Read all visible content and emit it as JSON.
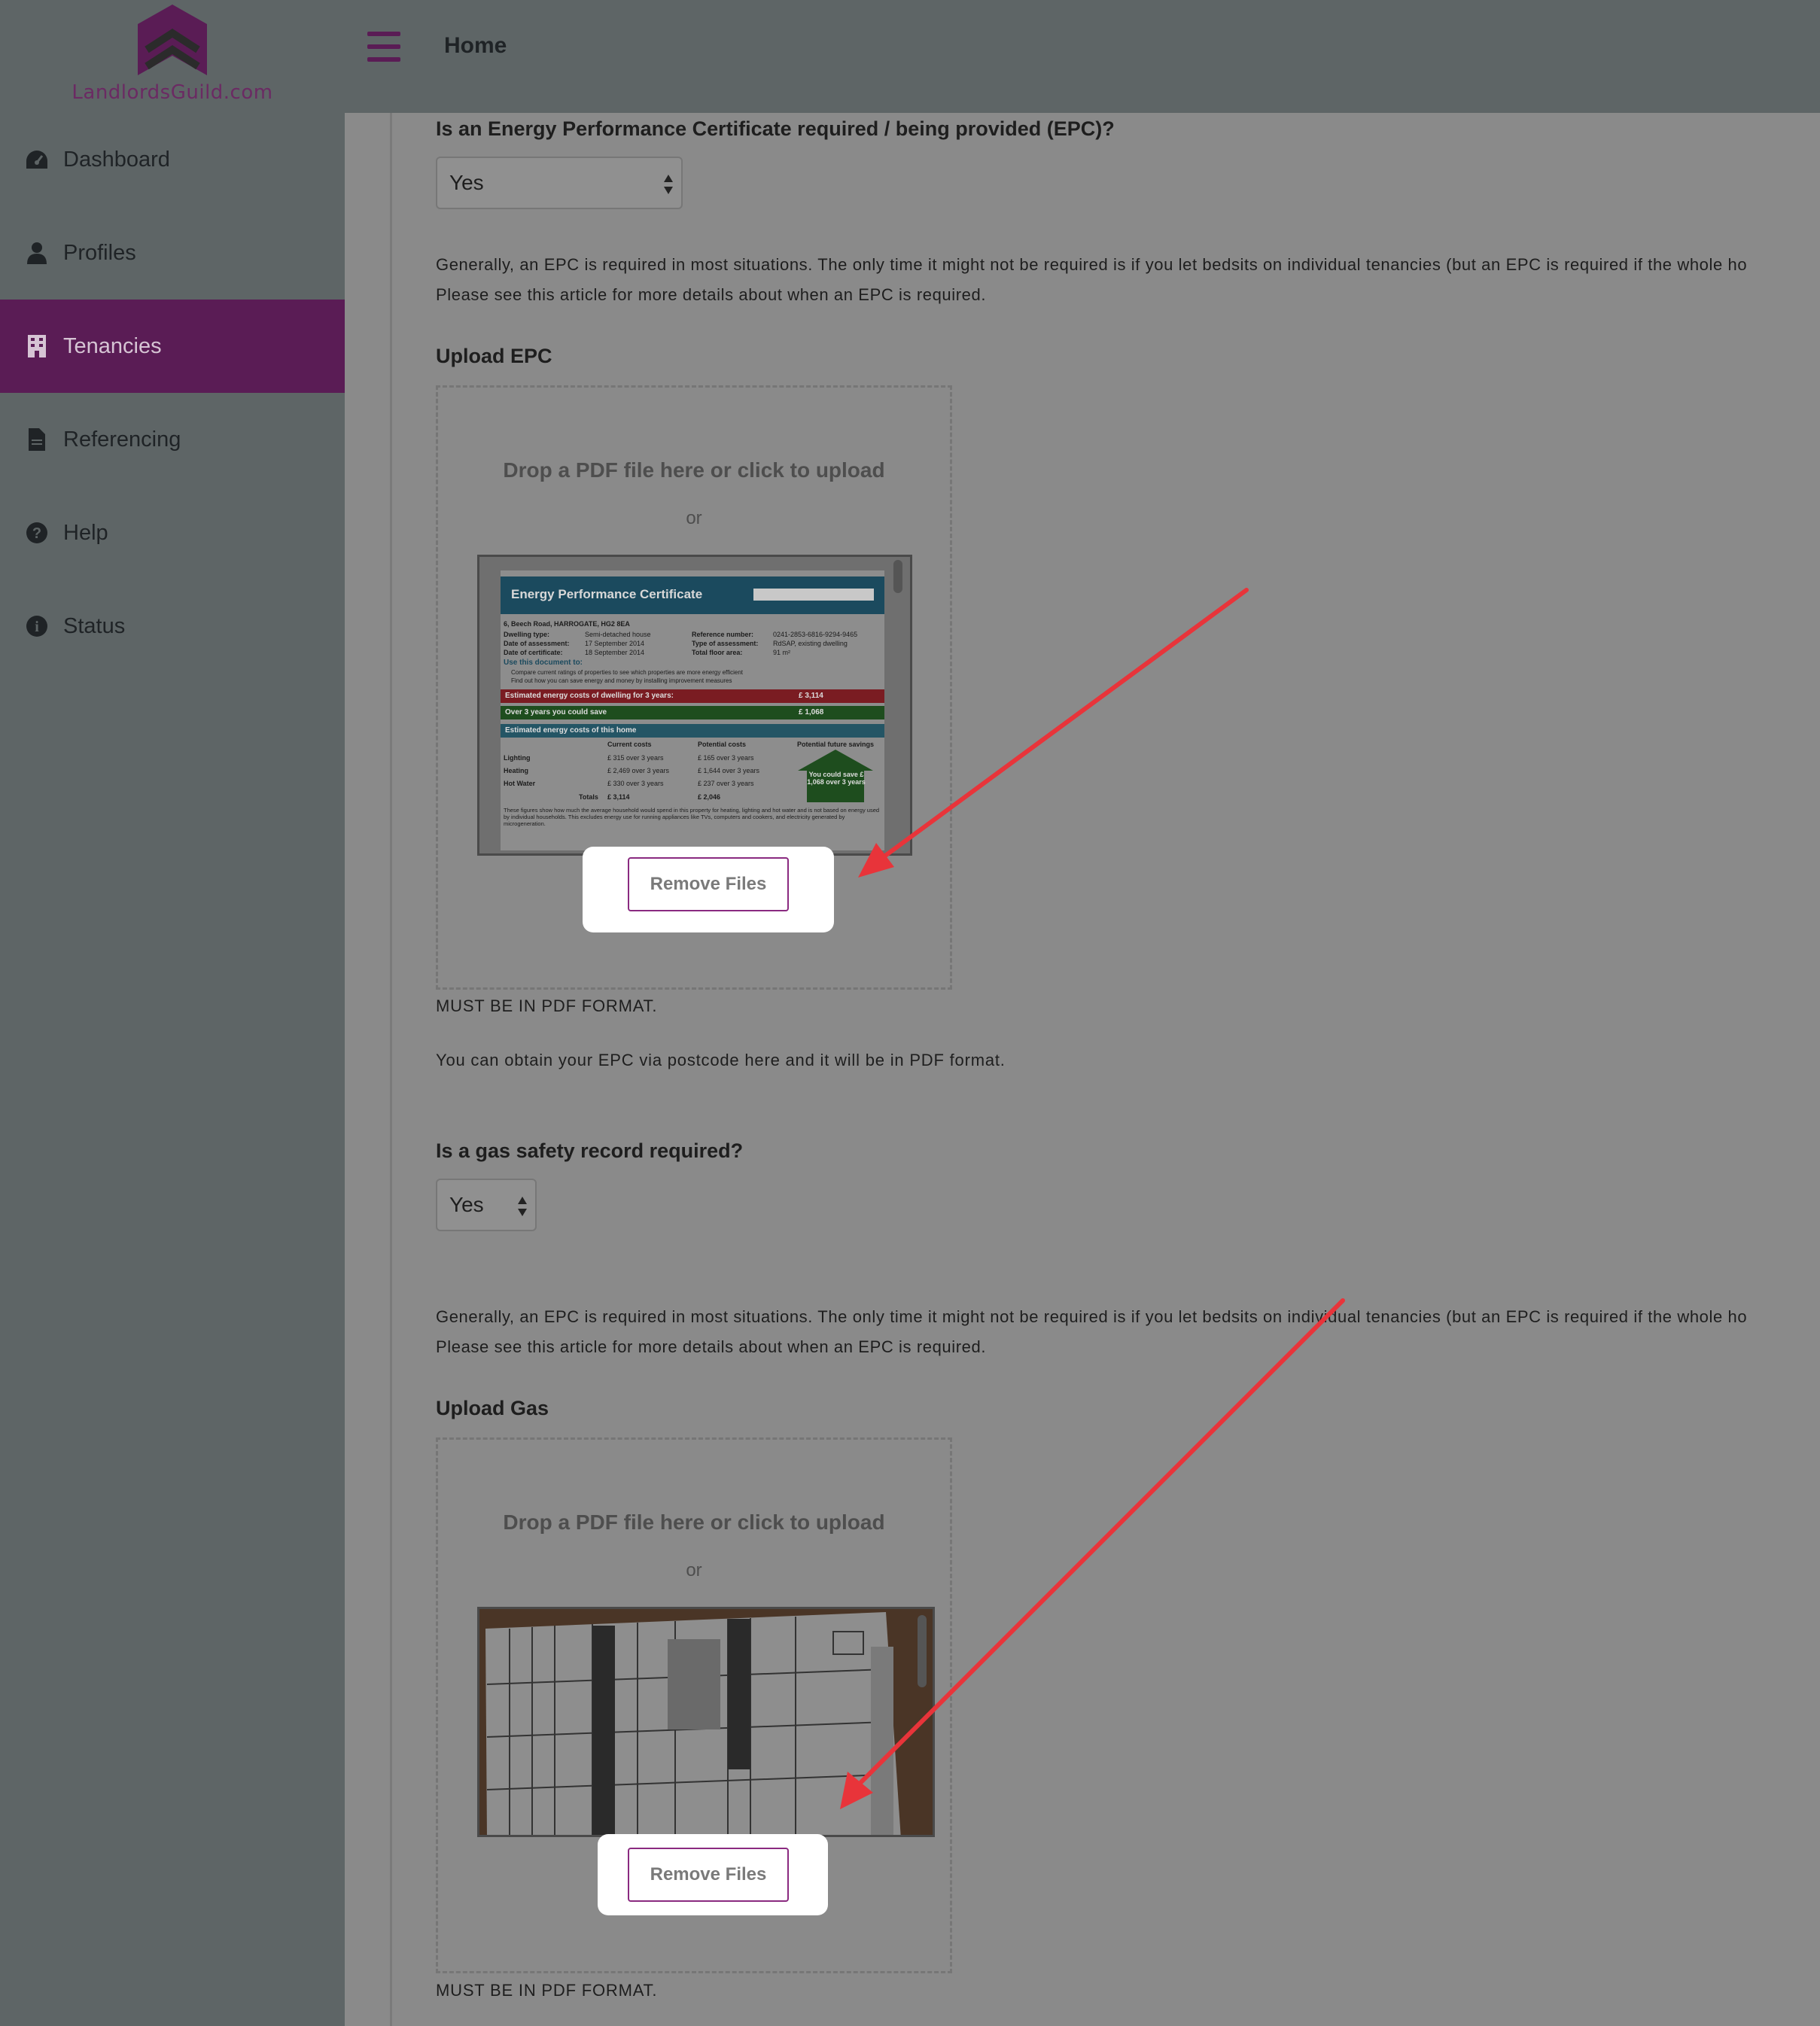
{
  "brand": {
    "logo_text": "LandlordsGuild.com",
    "accent": "#5a1c55",
    "logo_color": "#6b2a63"
  },
  "sidebar": {
    "items": [
      {
        "label": "Dashboard",
        "icon": "dashboard-icon",
        "active": false
      },
      {
        "label": "Profiles",
        "icon": "user-icon",
        "active": false
      },
      {
        "label": "Tenancies",
        "icon": "building-icon",
        "active": true
      },
      {
        "label": "Referencing",
        "icon": "file-icon",
        "active": false
      },
      {
        "label": "Help",
        "icon": "question-circle-icon",
        "active": false
      },
      {
        "label": "Status",
        "icon": "info-circle-icon",
        "active": false
      }
    ]
  },
  "header": {
    "title": "Home"
  },
  "epc": {
    "question": "Is an Energy Performance Certificate required / being provided (EPC)?",
    "select_value": "Yes",
    "info_line1": "Generally, an EPC is required in most situations. The only time it might not be required is if you let bedsits on individual tenancies (but an EPC is required if the whole ho",
    "info_line2": "Please see this article for more details about when an EPC is required.",
    "upload_heading": "Upload EPC",
    "drop_text": "Drop a PDF file here or click to upload",
    "or_text": "or",
    "remove_label": "Remove Files",
    "format_note": "MUST BE IN PDF FORMAT.",
    "obtain_note": "You can obtain your EPC via postcode here and it will be in PDF format.",
    "preview": {
      "title": "Energy Performance Certificate",
      "address": "6, Beech Road, HARROGATE, HG2 8EA",
      "dwelling_type_label": "Dwelling type:",
      "dwelling_type": "Semi-detached house",
      "date_assessment_label": "Date of assessment:",
      "date_assessment": "17   September   2014",
      "date_certificate_label": "Date of certificate:",
      "date_certificate": "18   September   2014",
      "reference_label": "Reference number:",
      "reference": "0241-2853-6816-9294-9465",
      "type_assessment_label": "Type of assessment:",
      "type_assessment": "RdSAP, existing dwelling",
      "floor_area_label": "Total floor area:",
      "floor_area": "91 m²",
      "use_doc": "Use this document to:",
      "bullet1": "Compare current ratings of properties to see which properties are more energy efficient",
      "bullet2": "Find out how you can save energy and money by installing improvement measures",
      "est_costs_label": "Estimated energy costs of dwelling for 3 years:",
      "est_costs": "£ 3,114",
      "save_label": "Over 3 years you could save",
      "save": "£ 1,068",
      "costs_home": "Estimated energy costs of this home",
      "col_current": "Current costs",
      "col_potential": "Potential costs",
      "col_future": "Potential future savings",
      "rows": [
        {
          "name": "Lighting",
          "current": "£ 315 over 3 years",
          "potential": "£ 165 over 3 years"
        },
        {
          "name": "Heating",
          "current": "£ 2,469 over 3 years",
          "potential": "£ 1,644 over 3 years"
        },
        {
          "name": "Hot Water",
          "current": "£ 330 over 3 years",
          "potential": "£ 237 over 3 years"
        }
      ],
      "totals_label": "Totals",
      "totals_current": "£ 3,114",
      "totals_potential": "£ 2,046",
      "house_text": "You could save £ 1,068 over 3 years",
      "footnote": "These figures show how much the average household would spend in this property for heating, lighting and hot water and is not based on energy used by individual households. This excludes energy use for running appliances like TVs, computers and cookers, and electricity generated by microgeneration."
    }
  },
  "gas": {
    "question": "Is a gas safety record required?",
    "select_value": "Yes",
    "info_line1": "Generally, an EPC is required in most situations. The only time it might not be required is if you let bedsits on individual tenancies (but an EPC is required if the whole ho",
    "info_line2": "Please see this article for more details about when an EPC is required.",
    "upload_heading": "Upload Gas",
    "drop_text": "Drop a PDF file here or click to upload",
    "or_text": "or",
    "remove_label": "Remove Files",
    "format_note": "MUST BE IN PDF FORMAT."
  },
  "annotation": {
    "arrow_color": "#e8343a"
  }
}
